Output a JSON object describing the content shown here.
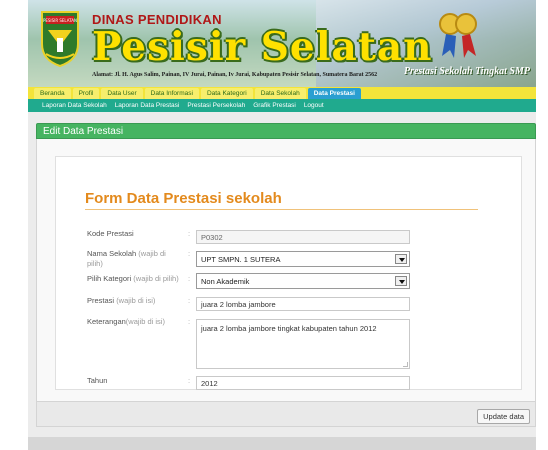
{
  "header": {
    "agency": "DINAS PENDIDIKAN",
    "brand": "Pesisir Selatan",
    "address": "Alamat: Jl. H. Agus Salim, Painan, IV Jurai, Painan, Iv Jurai, Kabupaten Pesisir Selatan, Sumatera Barat 2562",
    "tagline": "Prestasi Sekolah Tingkat SMP",
    "logo_text": "PESISIR SELATAN",
    "colors": {
      "brand_yellow": "#ffe100",
      "agency_red": "#b01717",
      "nav_yellow": "#f3e43a",
      "subnav_teal": "#20aa8e",
      "section_green": "#46b461",
      "title_orange": "#e38a1d"
    }
  },
  "topnav": {
    "items": [
      {
        "label": "Beranda"
      },
      {
        "label": "Profil"
      },
      {
        "label": "Data User"
      },
      {
        "label": "Data Informasi"
      },
      {
        "label": "Data Kategori"
      },
      {
        "label": "Data Sekolah"
      },
      {
        "label": "Data Prestasi",
        "active": true
      }
    ]
  },
  "subnav": {
    "items": [
      {
        "label": "Laporan Data Sekolah"
      },
      {
        "label": "Laporan Data Prestasi"
      },
      {
        "label": "Prestasi Persekolah"
      },
      {
        "label": "Grafik Prestasi"
      },
      {
        "label": "Logout"
      }
    ]
  },
  "section": {
    "title": "Edit Data Prestasi"
  },
  "form": {
    "title": "Form Data Prestasi sekolah",
    "colon": ":",
    "fields": {
      "kode": {
        "label": "Kode Prestasi",
        "hint": "",
        "value": "P0302"
      },
      "sekolah": {
        "label": "Nama Sekolah",
        "hint": "(wajib di pilih)",
        "value": "UPT SMPN. 1 SUTERA"
      },
      "kategori": {
        "label": "Pilih Kategori",
        "hint": "(wajib di pilih)",
        "value": "Non Akademik"
      },
      "prestasi": {
        "label": "Prestasi",
        "hint": "(wajib di isi)",
        "value": "juara 2 lomba jambore"
      },
      "keterangan": {
        "label": "Keterangan",
        "hint": "(wajib di isi)",
        "value": "juara 2 lomba jambore tingkat kabupaten tahun 2012"
      },
      "tahun": {
        "label": "Tahun",
        "hint": "",
        "value": "2012"
      }
    },
    "submit_label": "Update data"
  }
}
